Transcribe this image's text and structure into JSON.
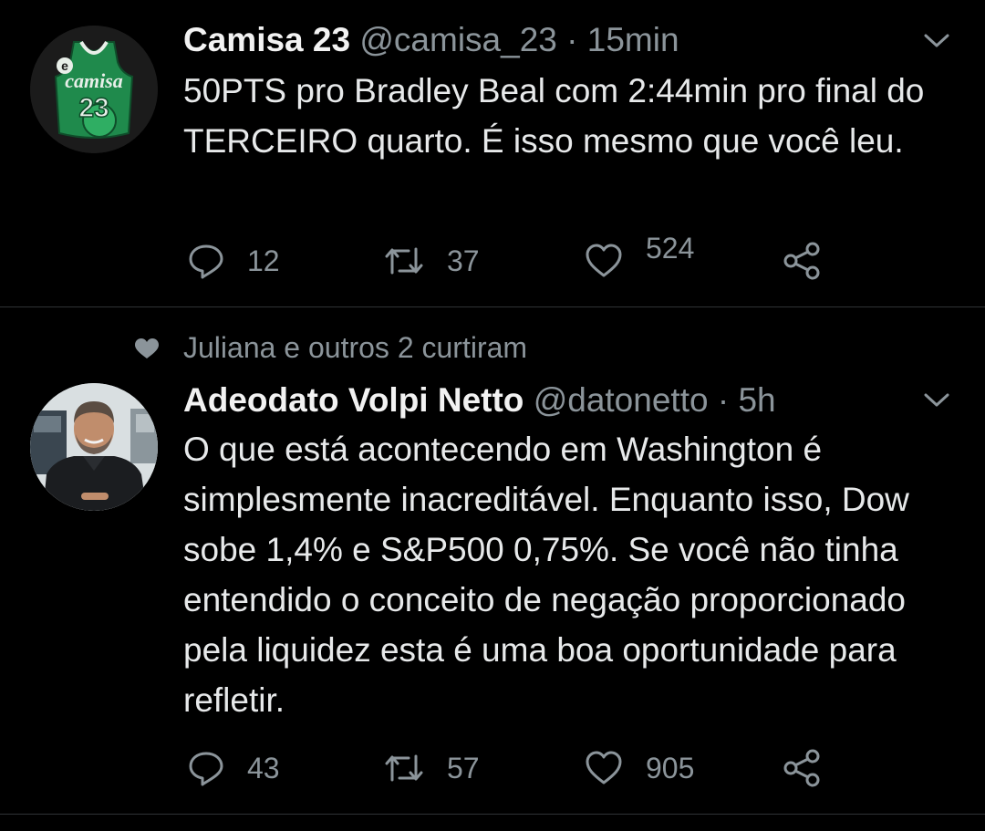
{
  "tweets": [
    {
      "name": "Camisa 23",
      "handle": "@camisa_23",
      "time": "15min",
      "sep": " · ",
      "text": "50PTS pro Bradley Beal com 2:44min pro final do TERCEIRO quarto. É isso mesmo que você leu.",
      "avatar_text_top": "e",
      "avatar_text_mid": "camisa",
      "avatar_text_num": "23",
      "replies": "12",
      "retweets": "37",
      "likes": "524"
    },
    {
      "social_context": "Juliana e outros 2 curtiram",
      "name": "Adeodato Volpi Netto",
      "handle": "@datonetto",
      "time": "5h",
      "sep": " · ",
      "text": "O que está acontecendo em Washington é simplesmente inacreditável. Enquanto isso, Dow sobe 1,4% e S&P500 0,75%. Se você não tinha entendido o conceito de negação proporcionado pela liquidez esta é uma boa oportunidade para refletir.",
      "replies": "43",
      "retweets": "57",
      "likes": "905"
    }
  ],
  "colors": {
    "background": "#000000",
    "text": "#e7e9ea",
    "muted": "#8b949a",
    "divider": "#2f3336",
    "jersey_green": "#1f8a4c"
  },
  "icons": [
    "reply-icon",
    "retweet-icon",
    "like-icon",
    "share-icon",
    "chevron-down-icon",
    "heart-icon"
  ]
}
